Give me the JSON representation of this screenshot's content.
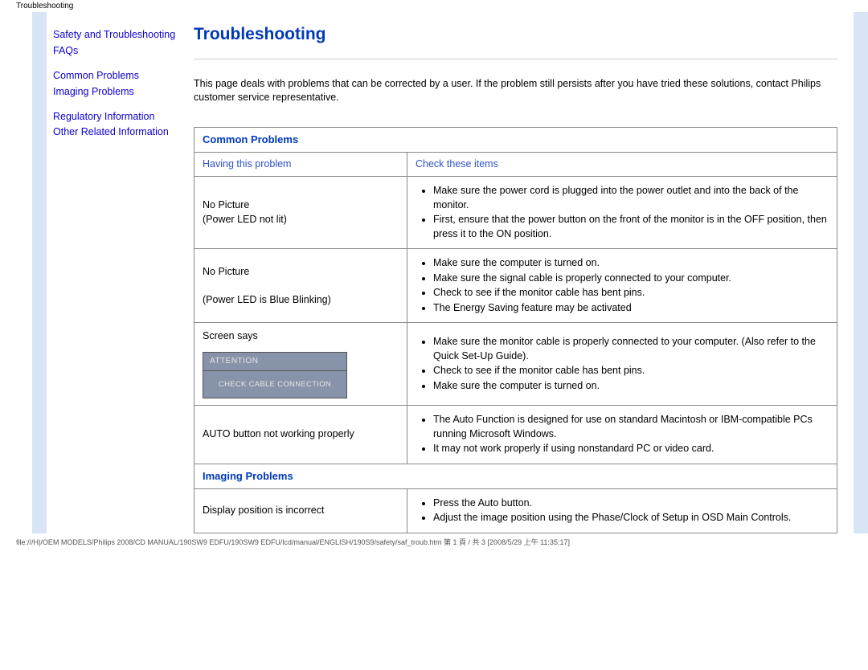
{
  "top_label": "Troubleshooting",
  "sidebar": {
    "links": [
      "Safety and Troubleshooting",
      "FAQs",
      "Common Problems",
      "Imaging Problems",
      "Regulatory Information",
      "Other Related Information"
    ]
  },
  "title": "Troubleshooting",
  "intro": "This page deals with problems that can be corrected by a user. If the problem still persists after you have tried these solutions, contact Philips customer service representative.",
  "sections": {
    "common_header": "Common Problems",
    "col_left_header": "Having this problem",
    "col_right_header": "Check these items",
    "rows": [
      {
        "problem_lines": [
          "No Picture",
          "(Power LED not lit)"
        ],
        "checks": [
          "Make sure the power cord is plugged into the power outlet and into the back of the monitor.",
          "First, ensure that the power button on the front of the monitor is in the OFF position, then press it to the ON position."
        ]
      },
      {
        "problem_lines": [
          "No Picture",
          "",
          "(Power LED is Blue Blinking)"
        ],
        "checks": [
          "Make sure the computer is turned on.",
          "Make sure the signal cable is properly connected to your computer.",
          "Check to see if the monitor cable has bent pins.",
          "The Energy Saving feature may be activated"
        ]
      },
      {
        "problem_lines": [
          "Screen says"
        ],
        "attention": {
          "title": "ATTENTION",
          "body": "CHECK CABLE CONNECTION"
        },
        "checks": [
          "Make sure the monitor cable is properly connected to your computer. (Also refer to the Quick Set-Up Guide).",
          "Check to see if the monitor cable has bent pins.",
          "Make sure the computer is turned on."
        ]
      },
      {
        "problem_lines": [
          "AUTO button not working properly"
        ],
        "checks": [
          "The Auto Function is designed for use on standard Macintosh or IBM-compatible PCs running Microsoft Windows.",
          "It may not work properly if using nonstandard PC or video card."
        ]
      }
    ],
    "imaging_header": "Imaging Problems",
    "imaging_rows": [
      {
        "problem_lines": [
          "Display position is incorrect"
        ],
        "checks": [
          "Press the Auto button.",
          "Adjust the image position using the Phase/Clock of Setup in OSD Main Controls."
        ]
      }
    ]
  },
  "footer": "file:///H|/OEM MODELS/Philips 2008/CD MANUAL/190SW9 EDFU/190SW9 EDFU/lcd/manual/ENGLISH/190S9/safety/saf_troub.htm 第 1 頁 / 共 3  [2008/5/29 上午 11:35:17]"
}
